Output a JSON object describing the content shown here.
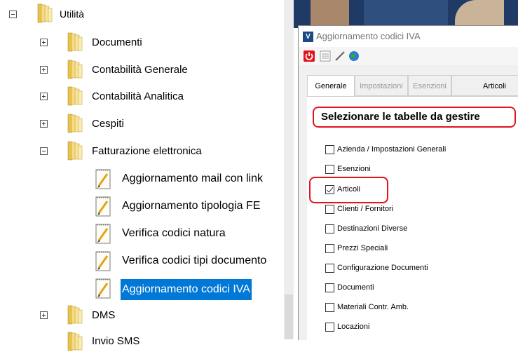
{
  "tree": {
    "root": {
      "label": "Utilità"
    },
    "items": [
      {
        "label": "Documenti"
      },
      {
        "label": "Contabilità Generale"
      },
      {
        "label": "Contabilità Analitica"
      },
      {
        "label": "Cespiti"
      },
      {
        "label": "Fatturazione elettronica"
      }
    ],
    "fe_children": [
      {
        "label": "Aggiornamento mail con link"
      },
      {
        "label": "Aggiornamento tipologia FE"
      },
      {
        "label": "Verifica codici natura"
      },
      {
        "label": "Verifica codici tipi documento"
      },
      {
        "label": "Aggiornamento codici IVA"
      }
    ],
    "after": [
      {
        "label": "DMS"
      },
      {
        "label": "Invio SMS"
      }
    ]
  },
  "dialog": {
    "title": "Aggiornamento codici IVA",
    "tabs": [
      "Generale",
      "Impostazioni",
      "Esenzioni",
      "Articoli"
    ],
    "heading": "Selezionare le tabelle da gestire",
    "options": [
      {
        "label": "Azienda / Impostazioni Generali",
        "checked": false
      },
      {
        "label": "Esenzioni",
        "checked": false
      },
      {
        "label": "Articoli",
        "checked": true
      },
      {
        "label": "Clienti / Fornitori",
        "checked": false
      },
      {
        "label": "Destinazioni Diverse",
        "checked": false
      },
      {
        "label": "Prezzi Speciali",
        "checked": false
      },
      {
        "label": "Configurazione Documenti",
        "checked": false
      },
      {
        "label": "Documenti",
        "checked": false
      },
      {
        "label": "Materiali Contr. Amb.",
        "checked": false
      },
      {
        "label": "Locazioni",
        "checked": false
      }
    ]
  },
  "colors": {
    "selection": "#0078d7",
    "highlight": "#e0141c"
  }
}
